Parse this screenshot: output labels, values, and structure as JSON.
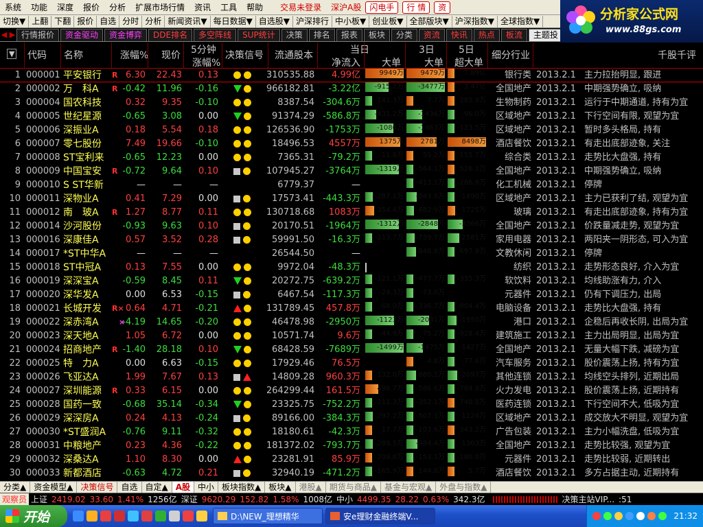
{
  "menu": {
    "items": [
      "系统",
      "功能",
      "深度",
      "报价",
      "分析",
      "扩展市场行情",
      "资讯",
      "工具",
      "帮助"
    ],
    "status": "交易未登录",
    "market": "深沪A股",
    "buttons": [
      "闪电手",
      "行 情",
      "资"
    ]
  },
  "logo": {
    "title": "分析家公式网",
    "url": "www.88gs.com"
  },
  "toolbar": [
    "切换▼",
    "上翻",
    "下翻",
    "报价",
    "自选",
    "分时",
    "分析",
    "新闻资讯▼",
    "每日数据▼",
    "自选股▼",
    "沪深排行",
    "中小板▼",
    "创业板▼",
    "全部版块▼",
    "沪深指数▼",
    "全球指数▼"
  ],
  "tabs": [
    {
      "label": "行情报价",
      "style": "plain"
    },
    {
      "label": "资金驱动",
      "style": "mag"
    },
    {
      "label": "资金博弈",
      "style": "mag"
    },
    {
      "label": "DDE排名",
      "style": "red"
    },
    {
      "label": "多空阵线",
      "style": "red"
    },
    {
      "label": "SUP统计",
      "style": "red"
    },
    {
      "label": "决策",
      "style": "plain"
    },
    {
      "label": "排名",
      "style": "plain"
    },
    {
      "label": "报表",
      "style": "plain"
    },
    {
      "label": "板块",
      "style": "plain"
    },
    {
      "label": "分类",
      "style": "plain"
    },
    {
      "label": "资流",
      "style": "red"
    },
    {
      "label": "快讯",
      "style": "red"
    },
    {
      "label": "热点",
      "style": "red"
    },
    {
      "label": "板流",
      "style": "red"
    },
    {
      "label": "主题投",
      "style": "active"
    }
  ],
  "columns": {
    "menu": "▼",
    "code": "代码",
    "name": "名称",
    "pct": "涨幅%",
    "price": "现价",
    "m5_top": "5分钟",
    "m5_bot": "涨幅%",
    "signal": "决策信号",
    "float_shares": "流通股本",
    "today": "当日",
    "inflow": "净流入",
    "big": "大单",
    "d3": "3日",
    "big3": "大单",
    "d5": "5日",
    "super5": "超大单",
    "industry": "细分行业",
    "comment": "千股千评"
  },
  "rows": [
    {
      "no": "1",
      "code": "000001",
      "name": "平安银行",
      "mark": "R",
      "pct": "6.30",
      "price": "22.43",
      "m5": "0.13",
      "sig": [
        "dot",
        "dot"
      ],
      "ltg": "310535.88",
      "inflow": "4.99亿",
      "t": [
        9949,
        "9949万"
      ],
      "d3": [
        9479,
        "9479万"
      ],
      "d5": [
        7.89,
        "7.89亿"
      ],
      "ind": "银行类",
      "date": "2013.2.1",
      "cmt": "主力拉抬明显, 跟进"
    },
    {
      "no": "2",
      "code": "000002",
      "name": "万　科A",
      "mark": "R",
      "pct": "-0.42",
      "price": "11.96",
      "m5": "-0.16",
      "sig": [
        "tdn",
        "dot"
      ],
      "ltg": "966182.81",
      "inflow": "-3.22亿",
      "t": [
        -915.2,
        "-915.2万"
      ],
      "d3": [
        -3477,
        "-3477万"
      ],
      "d5": [
        3.47,
        "3.47亿"
      ],
      "ind": "全国地产",
      "date": "2013.2.1",
      "cmt": "中期强势确立, 吸纳"
    },
    {
      "no": "3",
      "code": "000004",
      "name": "国农科技",
      "mark": "",
      "pct": "0.32",
      "price": "9.35",
      "m5": "-0.10",
      "sig": [
        "dot",
        "dot"
      ],
      "ltg": "8387.54",
      "inflow": "-304.6万",
      "t": [
        -141.3,
        "-141.3万"
      ],
      "d3": [
        7.7,
        "7.7万"
      ],
      "d5": [
        285.9,
        "285.9万"
      ],
      "ind": "生物制药",
      "date": "2013.2.1",
      "cmt": "运行于中期通道, 持有为宜"
    },
    {
      "no": "4",
      "code": "000005",
      "name": "世纪星源",
      "mark": "",
      "pct": "-0.65",
      "price": "3.08",
      "m5": "0.00",
      "sig": [
        "tdn",
        "dot"
      ],
      "ltg": "91374.29",
      "inflow": "-586.8万",
      "t": [
        -431.2,
        "-431.2万"
      ],
      "d3": [
        -1436,
        "-1436万"
      ],
      "d5": [
        -96.0,
        "-96.0万"
      ],
      "ind": "区域地产",
      "date": "2013.2.1",
      "cmt": "下行空间有限, 观望为宜"
    },
    {
      "no": "5",
      "code": "000006",
      "name": "深振业A",
      "mark": "",
      "pct": "0.18",
      "price": "5.54",
      "m5": "0.18",
      "sig": [
        "dot",
        "dot"
      ],
      "ltg": "126536.90",
      "inflow": "-1753万",
      "t": [
        -1086,
        "-1086万"
      ],
      "d3": [
        -1463,
        "-1463万"
      ],
      "d5": [
        -123.5,
        "-123.5万"
      ],
      "ind": "区域地产",
      "date": "2013.2.1",
      "cmt": "暂时多头格局, 持有"
    },
    {
      "no": "6",
      "code": "000007",
      "name": "零七股份",
      "mark": "",
      "pct": "7.49",
      "price": "19.66",
      "m5": "-0.10",
      "sig": [
        "dot",
        "dot"
      ],
      "ltg": "18496.53",
      "inflow": "4557万",
      "t": [
        1375,
        "1375万"
      ],
      "d3": [
        2781,
        "2781万"
      ],
      "d5": [
        8498,
        "8498万"
      ],
      "ind": "酒店餐饮",
      "date": "2013.2.1",
      "cmt": "有走出底部迹象, 关注"
    },
    {
      "no": "7",
      "code": "000008",
      "name": "ST宝利来",
      "mark": "",
      "pct": "-0.65",
      "price": "12.23",
      "m5": "0.00",
      "sig": [
        "dot",
        "dot"
      ],
      "ltg": "7365.31",
      "inflow": "-79.2万",
      "t": [
        -11.8,
        "-11.8万"
      ],
      "d3": [
        59.2,
        "59.2万"
      ],
      "d5": [
        155.7,
        "155.7万"
      ],
      "ind": "综合类",
      "date": "2013.2.1",
      "cmt": "走势比大盘强, 持有"
    },
    {
      "no": "8",
      "code": "000009",
      "name": "中国宝安",
      "mark": "R",
      "pct": "-0.72",
      "price": "9.64",
      "m5": "0.10",
      "sig": [
        "sq",
        "dot"
      ],
      "ltg": "107945.27",
      "inflow": "-3764万",
      "t": [
        -1319,
        "-1319万"
      ],
      "d3": [
        -564.1,
        "-564.1万"
      ],
      "d5": [
        526.1,
        "526.1万"
      ],
      "ind": "全国地产",
      "date": "2013.2.1",
      "cmt": "中期强势确立, 吸纳"
    },
    {
      "no": "9",
      "code": "000010",
      "name": "S ST华新",
      "mark": "",
      "pct": "—",
      "price": "—",
      "m5": "—",
      "sig": [],
      "ltg": "6779.37",
      "inflow": "—",
      "t": [
        0,
        ""
      ],
      "d3": [
        -413.1,
        "-413.1万"
      ],
      "d5": [
        -286.9,
        "-286.9万"
      ],
      "ind": "化工机械",
      "date": "2013.2.1",
      "cmt": "停牌"
    },
    {
      "no": "10",
      "code": "000011",
      "name": "深物业A",
      "mark": "",
      "pct": "0.41",
      "price": "7.29",
      "m5": "0.00",
      "sig": [
        "sq",
        "dot"
      ],
      "ltg": "17573.41",
      "inflow": "-443.3万",
      "t": [
        -287.1,
        "-287.1万"
      ],
      "d3": [
        -943.9,
        "-943.9万"
      ],
      "d5": [
        -1490,
        "-1490万"
      ],
      "ind": "区域地产",
      "date": "2013.2.1",
      "cmt": "主力已获利了结, 观望为宜"
    },
    {
      "no": "11",
      "code": "000012",
      "name": "南　玻A",
      "mark": "R",
      "pct": "1.27",
      "price": "8.77",
      "m5": "0.11",
      "sig": [
        "dot",
        "dot"
      ],
      "ltg": "130718.68",
      "inflow": "1083万",
      "t": [
        354.4,
        "354.4万"
      ],
      "d3": [
        -682.9,
        "-682.9万"
      ],
      "d5": [
        1725,
        "1725万"
      ],
      "ind": "玻璃",
      "date": "2013.2.1",
      "cmt": "有走出底部迹象, 持有为宜"
    },
    {
      "no": "12",
      "code": "000014",
      "name": "沙河股份",
      "mark": "",
      "pct": "-0.93",
      "price": "9.63",
      "m5": "0.10",
      "sig": [
        "sq",
        "dot"
      ],
      "ltg": "20170.51",
      "inflow": "-1964万",
      "t": [
        -1312,
        "-1312万"
      ],
      "d3": [
        -2848,
        "-2848万"
      ],
      "d5": [
        -3366,
        "-3366万"
      ],
      "ind": "全国地产",
      "date": "2013.2.1",
      "cmt": "价跌量减走势, 观望为宜"
    },
    {
      "no": "13",
      "code": "000016",
      "name": "深康佳A",
      "mark": "",
      "pct": "0.57",
      "price": "3.52",
      "m5": "0.28",
      "sig": [
        "sq",
        "dot"
      ],
      "ltg": "59991.50",
      "inflow": "-16.3万",
      "t": [
        -213.7,
        "-213.7万"
      ],
      "d3": [
        -739.7,
        "-739.7万"
      ],
      "d5": [
        -2581,
        "-2581万"
      ],
      "ind": "家用电器",
      "date": "2013.2.1",
      "cmt": "两阳夹一阴形态, 可入为宜"
    },
    {
      "no": "14",
      "code": "000017",
      "name": "*ST中华A",
      "mark": "",
      "pct": "—",
      "price": "—",
      "m5": "—",
      "sig": [],
      "ltg": "26544.50",
      "inflow": "—",
      "t": [
        0,
        ""
      ],
      "d3": [
        -848.9,
        "-848.9万"
      ],
      "d5": [
        -697.9,
        "-697.9万"
      ],
      "ind": "文教休闲",
      "date": "2013.2.1",
      "cmt": "停牌"
    },
    {
      "no": "15",
      "code": "000018",
      "name": "ST中冠A",
      "mark": "",
      "pct": "0.13",
      "price": "7.55",
      "m5": "0.00",
      "sig": [
        "dot",
        "dot"
      ],
      "ltg": "9972.04",
      "inflow": "-48.3万",
      "t": [
        0,
        ""
      ],
      "d3": [
        0,
        ""
      ],
      "d5": [
        0,
        ""
      ],
      "ind": "纺织",
      "date": "2013.2.1",
      "cmt": "走势形态良好, 介入为宜"
    },
    {
      "no": "16",
      "code": "000019",
      "name": "深深宝A",
      "mark": "",
      "pct": "-0.59",
      "price": "8.45",
      "m5": "0.11",
      "sig": [
        "tdn",
        "dot"
      ],
      "ltg": "20272.75",
      "inflow": "-639.2万",
      "t": [
        -121.1,
        "-121.1万"
      ],
      "d3": [
        -477.7,
        "-477.7万"
      ],
      "d5": [
        -335.3,
        "-335.3万"
      ],
      "ind": "软饮料",
      "date": "2013.2.1",
      "cmt": "均线助涨有力, 介入"
    },
    {
      "no": "17",
      "code": "000020",
      "name": "深华发A",
      "mark": "",
      "pct": "0.00",
      "price": "6.53",
      "m5": "-0.15",
      "sig": [
        "sq",
        "dot"
      ],
      "ltg": "6467.54",
      "inflow": "-117.3万",
      "t": [
        -24.3,
        "-24.3万"
      ],
      "d3": [
        -73.0,
        "-73.0万"
      ],
      "d5": [
        0,
        ""
      ],
      "ind": "元器件",
      "date": "2013.2.1",
      "cmt": "仍有下调压力, 出局"
    },
    {
      "no": "18",
      "code": "000021",
      "name": "长城开发",
      "mark": "R×",
      "pct": "0.64",
      "price": "4.71",
      "m5": "-0.21",
      "sig": [
        "tup",
        "dot"
      ],
      "ltg": "131789.45",
      "inflow": "457.8万",
      "t": [
        -68.0,
        "-68.0万"
      ],
      "d3": [
        -336.7,
        "-336.7万"
      ],
      "d5": [
        -804.4,
        "-804.4万"
      ],
      "ind": "电脑设备",
      "date": "2013.2.1",
      "cmt": "走势比大盘强, 持有"
    },
    {
      "no": "19",
      "code": "000022",
      "name": "深赤湾A",
      "mark": "×",
      "pct": "-4.19",
      "price": "14.65",
      "m5": "-0.20",
      "sig": [
        "dot",
        "dot"
      ],
      "ltg": "46478.98",
      "inflow": "-2950万",
      "t": [
        -1123,
        "-1123万"
      ],
      "d3": [
        -2041,
        "-2041万"
      ],
      "d5": [
        -1950,
        "-1950万"
      ],
      "ind": "港口",
      "date": "2013.2.1",
      "cmt": "企稳后再收长阴, 出局为宜"
    },
    {
      "no": "20",
      "code": "000023",
      "name": "深天地A",
      "mark": "",
      "pct": "1.05",
      "price": "6.72",
      "m5": "0.00",
      "sig": [
        "dot",
        "dot"
      ],
      "ltg": "10571.74",
      "inflow": "9.6万",
      "t": [
        -44.8,
        "-44.8万"
      ],
      "d3": [
        -75.2,
        "-75.2万"
      ],
      "d5": [
        -928.4,
        "-928.4万"
      ],
      "ind": "建筑施工",
      "date": "2013.2.1",
      "cmt": "主力出局明显, 出局为宜"
    },
    {
      "no": "21",
      "code": "000024",
      "name": "招商地产",
      "mark": "R",
      "pct": "-1.40",
      "price": "28.18",
      "m5": "0.10",
      "sig": [
        "tdn",
        "dot"
      ],
      "ltg": "68428.59",
      "inflow": "-7689万",
      "t": [
        -1499,
        "-1499万"
      ],
      "d3": [
        -1475,
        "-1475万"
      ],
      "d5": [
        -1427,
        "-1427万"
      ],
      "ind": "全国地产",
      "date": "2013.2.1",
      "cmt": "无量大幅下跌, 减磅为宜"
    },
    {
      "no": "22",
      "code": "000025",
      "name": "特　力A",
      "mark": "",
      "pct": "0.00",
      "price": "6.63",
      "m5": "-0.15",
      "sig": [
        "dot",
        "dot"
      ],
      "ltg": "17929.46",
      "inflow": "76.5万",
      "t": [
        0,
        ""
      ],
      "d3": [
        4.8,
        "4.8万"
      ],
      "d5": [
        -77.6,
        "-77.6万"
      ],
      "ind": "汽车服务",
      "date": "2013.2.1",
      "cmt": "股价震荡上扬, 持有为宜"
    },
    {
      "no": "23",
      "code": "000026",
      "name": "飞亚达A",
      "mark": "",
      "pct": "1.99",
      "price": "7.67",
      "m5": "0.13",
      "sig": [
        "sq",
        "tup"
      ],
      "ltg": "14809.28",
      "inflow": "960.3万",
      "t": [
        132.0,
        "132.0万"
      ],
      "d3": [
        -880.1,
        "-880.1万"
      ],
      "d5": [
        -2097,
        "-2097万"
      ],
      "ind": "其他连锁",
      "date": "2013.2.1",
      "cmt": "均线空头排列, 近期出局"
    },
    {
      "no": "24",
      "code": "000027",
      "name": "深圳能源",
      "mark": "R",
      "pct": "0.33",
      "price": "6.15",
      "m5": "0.00",
      "sig": [
        "dot",
        "dot"
      ],
      "ltg": "264299.44",
      "inflow": "161.5万",
      "t": [
        498.7,
        "498.7万"
      ],
      "d3": [
        -586.6,
        "-586.6万"
      ],
      "d5": [
        -784.9,
        "-784.9万"
      ],
      "ind": "火力发电",
      "date": "2013.2.1",
      "cmt": "股价震荡上扬, 近期持有"
    },
    {
      "no": "25",
      "code": "000028",
      "name": "国药一致",
      "mark": "",
      "pct": "-0.68",
      "price": "35.14",
      "m5": "-0.34",
      "sig": [
        "tdn",
        "dot"
      ],
      "ltg": "23325.75",
      "inflow": "-752.2万",
      "t": [
        -211.3,
        "-211.3万"
      ],
      "d3": [
        -352.1,
        "-352.1万"
      ],
      "d5": [
        740.5,
        "740.5万"
      ],
      "ind": "医药连锁",
      "date": "2013.2.1",
      "cmt": "下行空间不大, 低吸为宜"
    },
    {
      "no": "26",
      "code": "000029",
      "name": "深深房A",
      "mark": "",
      "pct": "0.24",
      "price": "4.13",
      "m5": "-0.24",
      "sig": [
        "sq",
        "dot"
      ],
      "ltg": "89166.00",
      "inflow": "-384.3万",
      "t": [
        -297.2,
        "-297.2万"
      ],
      "d3": [
        -507.1,
        "-507.1万"
      ],
      "d5": [
        -1124,
        "-1124万"
      ],
      "ind": "区域地产",
      "date": "2013.2.1",
      "cmt": "成交放大不明显, 观望为宜"
    },
    {
      "no": "27",
      "code": "000030",
      "name": "*ST盛润A",
      "mark": "",
      "pct": "-0.76",
      "price": "9.11",
      "m5": "-0.32",
      "sig": [
        "dot",
        "dot"
      ],
      "ltg": "18180.61",
      "inflow": "-42.3万",
      "t": [
        17.7,
        "17.7万"
      ],
      "d3": [
        -103.6,
        "-103.6万"
      ],
      "d5": [
        343.2,
        "343.2万"
      ],
      "ind": "广告包装",
      "date": "2013.2.1",
      "cmt": "主力小幅洗盘, 低吸为宜"
    },
    {
      "no": "28",
      "code": "000031",
      "name": "中粮地产",
      "mark": "",
      "pct": "0.23",
      "price": "4.36",
      "m5": "-0.22",
      "sig": [
        "dot",
        "dot"
      ],
      "ltg": "181372.02",
      "inflow": "-793.7万",
      "t": [
        -289.5,
        "-289.5万"
      ],
      "d3": [
        -984.4,
        "-984.4万"
      ],
      "d5": [
        -1303,
        "-1303万"
      ],
      "ind": "全国地产",
      "date": "2013.2.1",
      "cmt": "走势比较强, 观望为宜"
    },
    {
      "no": "29",
      "code": "000032",
      "name": "深桑达A",
      "mark": "",
      "pct": "1.10",
      "price": "8.30",
      "m5": "0.00",
      "sig": [
        "tup",
        "dot"
      ],
      "ltg": "23281.91",
      "inflow": "85.9万",
      "t": [
        209.8,
        "209.8万"
      ],
      "d3": [
        -153.1,
        "-153.1万"
      ],
      "d5": [
        -180.0,
        "-180.0万"
      ],
      "ind": "元器件",
      "date": "2013.2.1",
      "cmt": "走势比较弱, 近期转出"
    },
    {
      "no": "30",
      "code": "000033",
      "name": "新都酒店",
      "mark": "",
      "pct": "-0.63",
      "price": "4.72",
      "m5": "0.21",
      "sig": [
        "sq",
        "dot"
      ],
      "ltg": "32940.19",
      "inflow": "-471.2万",
      "t": [
        -165.9,
        "-165.9万"
      ],
      "d3": [
        144.8,
        "144.8万"
      ],
      "d5": [
        5.7,
        "5.7万"
      ],
      "ind": "酒店餐饮",
      "date": "2013.2.1",
      "cmt": "多方占据主动, 近期持有"
    }
  ],
  "bottom_tabs": [
    {
      "label": "分类▲",
      "style": "plain"
    },
    {
      "label": "资金模型▲",
      "style": "plain"
    },
    {
      "label": "决策信号",
      "style": "red"
    },
    {
      "label": "自选",
      "style": "plain"
    },
    {
      "label": "自定▲",
      "style": "plain"
    },
    {
      "label": "A股",
      "style": "active"
    },
    {
      "label": "中小",
      "style": "plain"
    },
    {
      "label": "板块指数▲",
      "style": "plain"
    },
    {
      "label": "板块▲",
      "style": "plain"
    },
    {
      "label": "港股▲",
      "style": "dim"
    },
    {
      "label": "期货与商品▲",
      "style": "dim"
    },
    {
      "label": "基金与宏观▲",
      "style": "dim"
    },
    {
      "label": "外盘与指数▲",
      "style": "dim"
    }
  ],
  "status": {
    "observer": "观察员",
    "sh_label": "上证",
    "sh_idx": "2419.02",
    "sh_chg": "33.60",
    "sh_pct": "1.41%",
    "sh_amt": "1256亿",
    "sz_label": "深证",
    "sz_idx": "9620.29",
    "sz_chg": "152.82",
    "sz_pct": "1.58%",
    "sz_amt": "1008亿",
    "zx_label": "中小",
    "zx_idx": "4499.35",
    "zx_chg": "28.22",
    "zx_pct": "0.63%",
    "zx_amt": "342.3亿",
    "server": "决策主站VIP...",
    "port": ":51"
  },
  "taskbar": {
    "start": "开始",
    "tasks": [
      "D:\\NEW_理想精华",
      "安e理财金融终端V..."
    ],
    "time": "21:32"
  }
}
